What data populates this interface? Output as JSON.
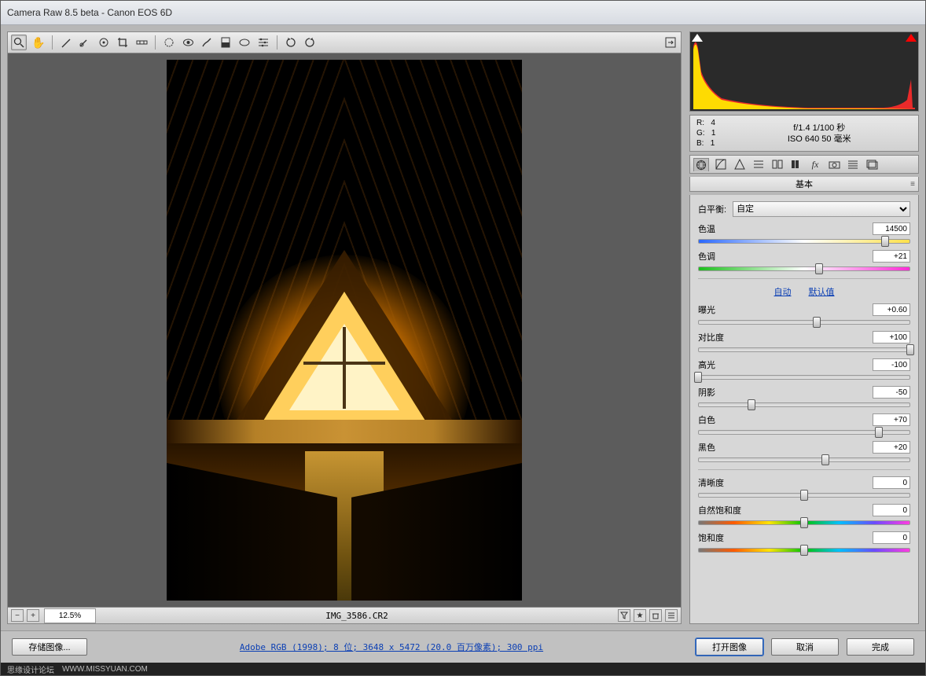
{
  "window": {
    "title": "Camera Raw 8.5 beta  -  Canon EOS 6D"
  },
  "meta": {
    "rgb": {
      "R": "4",
      "G": "1",
      "B": "1"
    },
    "exif_line1": "f/1.4   1/100 秒",
    "exif_line2": "ISO 640   50 毫米"
  },
  "panel": {
    "title": "基本",
    "wb_label": "白平衡:",
    "wb_value": "自定",
    "auto": "自动",
    "default": "默认值"
  },
  "sliders": {
    "temp": {
      "label": "色温",
      "value": "14500",
      "pos": 88,
      "bar": "temp"
    },
    "tint": {
      "label": "色调",
      "value": "+21",
      "pos": 57,
      "bar": "tint"
    },
    "exposure": {
      "label": "曝光",
      "value": "+0.60",
      "pos": 56,
      "bar": "gray"
    },
    "contrast": {
      "label": "对比度",
      "value": "+100",
      "pos": 100,
      "bar": "gray"
    },
    "highlight": {
      "label": "高光",
      "value": "-100",
      "pos": 0,
      "bar": "gray"
    },
    "shadow": {
      "label": "阴影",
      "value": "-50",
      "pos": 25,
      "bar": "gray"
    },
    "white": {
      "label": "白色",
      "value": "+70",
      "pos": 85,
      "bar": "gray"
    },
    "black": {
      "label": "黑色",
      "value": "+20",
      "pos": 60,
      "bar": "gray"
    },
    "clarity": {
      "label": "清晰度",
      "value": "0",
      "pos": 50,
      "bar": "gray"
    },
    "vibrance": {
      "label": "自然饱和度",
      "value": "0",
      "pos": 50,
      "bar": "vib"
    },
    "saturate": {
      "label": "饱和度",
      "value": "0",
      "pos": 50,
      "bar": "vib"
    }
  },
  "status": {
    "zoom": "12.5%",
    "filename": "IMG_3586.CR2"
  },
  "footer": {
    "save": "存储图像...",
    "info": "Adobe RGB (1998); 8 位;  3648 x 5472 (20.0 百万像素); 300 ppi",
    "open": "打开图像",
    "cancel": "取消",
    "done": "完成"
  },
  "watermark": {
    "site": "思缘设计论坛",
    "url": "WWW.MISSYUAN.COM"
  }
}
